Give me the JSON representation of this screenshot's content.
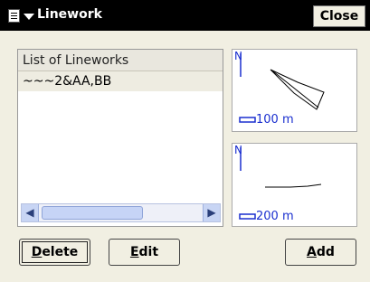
{
  "title": "Linework",
  "close_label": "Close",
  "list": {
    "header": "List of Lineworks",
    "items": [
      "~~~2&AA,BB"
    ]
  },
  "maps": [
    {
      "north": "N",
      "scale": "100 m"
    },
    {
      "north": "N",
      "scale": "200 m"
    }
  ],
  "buttons": {
    "delete": {
      "label": "Delete",
      "underline": "D",
      "rest": "elete"
    },
    "edit": {
      "label": "Edit",
      "underline": "E",
      "rest": "dit"
    },
    "add": {
      "label": "Add",
      "underline": "A",
      "rest": "dd"
    }
  },
  "colors": {
    "titlebar": "#000000",
    "background": "#f1efe2",
    "map_accent": "#1a2fcf"
  }
}
